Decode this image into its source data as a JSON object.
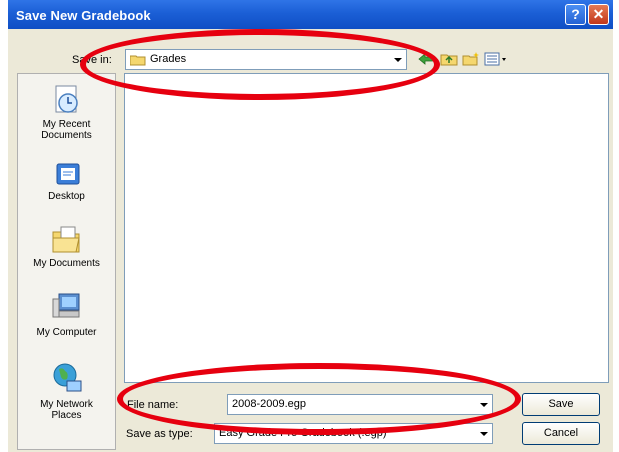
{
  "window": {
    "title": "Save New Gradebook",
    "help_label": "?",
    "close_label": "✕"
  },
  "toolbar": {
    "save_in_label": "Save in:",
    "save_in_value": "Grades",
    "icons": [
      "back-arrow-icon",
      "up-folder-icon",
      "new-folder-icon",
      "view-menu-icon"
    ]
  },
  "places": [
    {
      "name": "recent",
      "label_line1": "My Recent",
      "label_line2": "Documents"
    },
    {
      "name": "desktop",
      "label_line1": "Desktop",
      "label_line2": ""
    },
    {
      "name": "documents",
      "label_line1": "My Documents",
      "label_line2": ""
    },
    {
      "name": "computer",
      "label_line1": "My Computer",
      "label_line2": ""
    },
    {
      "name": "network",
      "label_line1": "My Network",
      "label_line2": "Places"
    }
  ],
  "form": {
    "file_name_label": "File name:",
    "file_name_value": "2008-2009.egp",
    "save_as_type_label": "Save as type:",
    "save_as_type_value": "Easy Grade Pro Gradebook (.egp)"
  },
  "buttons": {
    "save_label": "Save",
    "cancel_label": "Cancel"
  },
  "colors": {
    "titlebar": "#1b5fd6",
    "dialog_bg": "#ece9d8",
    "annotation": "#e6000f"
  }
}
